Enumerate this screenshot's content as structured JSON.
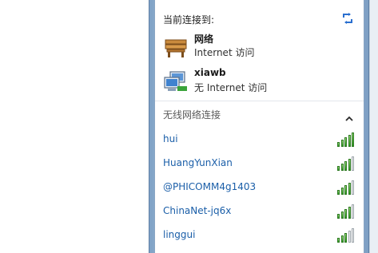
{
  "header": {
    "title": "当前连接到:",
    "refresh_icon": "refresh-icon"
  },
  "connections": [
    {
      "name": "网络",
      "status": "Internet 访问",
      "icon": "network-bench-icon"
    },
    {
      "name": "xiawb",
      "status": "无 Internet 访问",
      "icon": "computer-network-icon"
    }
  ],
  "wireless": {
    "section_title": "无线网络连接",
    "collapse_icon": "chevron-up-icon",
    "networks": [
      {
        "name": "hui",
        "signal_bars": 5
      },
      {
        "name": "HuangYunXian",
        "signal_bars": 4
      },
      {
        "name": "@PHICOMM4g1403",
        "signal_bars": 4
      },
      {
        "name": "ChinaNet-jq6x",
        "signal_bars": 4
      },
      {
        "name": "linggui",
        "signal_bars": 3
      }
    ]
  },
  "colors": {
    "link": "#1a5ea8",
    "frame": "#a9c4df"
  }
}
